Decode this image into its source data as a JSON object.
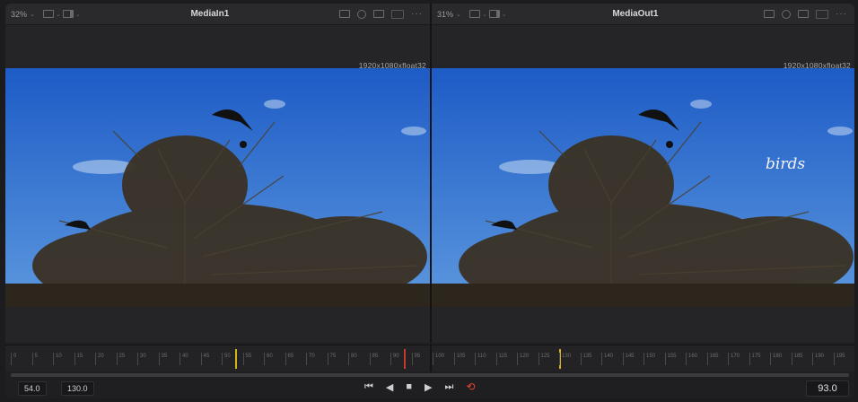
{
  "left_viewer": {
    "zoom": "32%",
    "title": "MediaIn1",
    "resolution": "1920x1080xfloat32"
  },
  "right_viewer": {
    "zoom": "31%",
    "title": "MediaOut1",
    "resolution": "1920x1080xfloat32",
    "overlay_text": "birds"
  },
  "ruler": {
    "ticks": [
      "0",
      "5",
      "10",
      "15",
      "20",
      "25",
      "30",
      "35",
      "40",
      "45",
      "50",
      "55",
      "60",
      "65",
      "70",
      "75",
      "80",
      "85",
      "90",
      "95",
      "100",
      "105",
      "110",
      "115",
      "120",
      "125",
      "130",
      "135",
      "140",
      "145",
      "150",
      "155",
      "160",
      "165",
      "170",
      "175",
      "180",
      "185",
      "190",
      "195"
    ]
  },
  "transport": {
    "start_frame": "54.0",
    "end_frame": "130.0",
    "current_frame": "93.0",
    "buttons": {
      "go_to_start": "⏮",
      "step_back": "◀",
      "stop": "■",
      "play": "▶",
      "go_to_end": "⏭",
      "loop": "⟲"
    }
  },
  "colors": {
    "sky_top": "#1f5fc9",
    "sky_bottom": "#5a96dd",
    "playhead": "#d2b31c",
    "loop_active": "#e0462f"
  }
}
